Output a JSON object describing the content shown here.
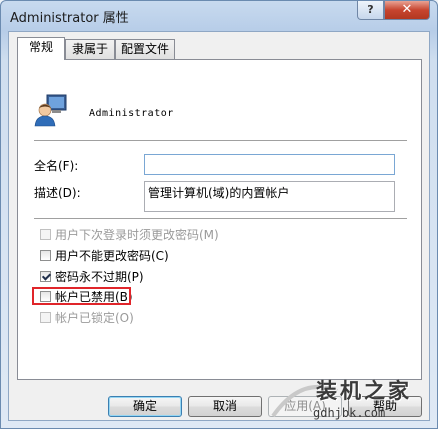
{
  "window": {
    "title": "Administrator 属性",
    "help_glyph": "?",
    "close_glyph": "✕"
  },
  "tabs": [
    {
      "label": "常规",
      "active": true
    },
    {
      "label": "隶属于",
      "active": false
    },
    {
      "label": "配置文件",
      "active": false
    }
  ],
  "user": {
    "name": "Administrator",
    "icon": "user-account-icon"
  },
  "fields": {
    "fullname_label": "全名(F):",
    "fullname_value": "",
    "description_label": "描述(D):",
    "description_value": "管理计算机(域)的内置帐户"
  },
  "checkboxes": [
    {
      "label": "用户下次登录时须更改密码(M)",
      "checked": false,
      "disabled": true
    },
    {
      "label": "用户不能更改密码(C)",
      "checked": false,
      "disabled": false
    },
    {
      "label": "密码永不过期(P)",
      "checked": true,
      "disabled": false
    },
    {
      "label": "帐户已禁用(B)",
      "checked": false,
      "disabled": false
    },
    {
      "label": "帐户已锁定(O)",
      "checked": false,
      "disabled": true
    }
  ],
  "buttons": {
    "ok": "确定",
    "cancel": "取消",
    "apply": "应用(A)",
    "help": "帮助"
  },
  "watermark": {
    "text": "装机之家",
    "url": "gdhjbk.com"
  },
  "colors": {
    "highlight": "#e0252a",
    "input_border": "#7aa7d4"
  }
}
